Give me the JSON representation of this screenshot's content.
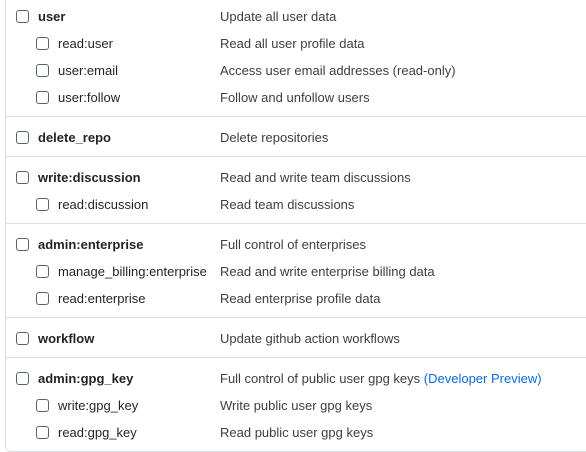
{
  "groups": [
    {
      "parent": {
        "name": "user",
        "desc": "Update all user data"
      },
      "children": [
        {
          "name": "read:user",
          "desc": "Read all user profile data"
        },
        {
          "name": "user:email",
          "desc": "Access user email addresses (read-only)"
        },
        {
          "name": "user:follow",
          "desc": "Follow and unfollow users"
        }
      ]
    },
    {
      "parent": {
        "name": "delete_repo",
        "desc": "Delete repositories"
      },
      "children": []
    },
    {
      "parent": {
        "name": "write:discussion",
        "desc": "Read and write team discussions"
      },
      "children": [
        {
          "name": "read:discussion",
          "desc": "Read team discussions"
        }
      ]
    },
    {
      "parent": {
        "name": "admin:enterprise",
        "desc": "Full control of enterprises"
      },
      "children": [
        {
          "name": "manage_billing:enterprise",
          "desc": "Read and write enterprise billing data"
        },
        {
          "name": "read:enterprise",
          "desc": "Read enterprise profile data"
        }
      ]
    },
    {
      "parent": {
        "name": "workflow",
        "desc": "Update github action workflows"
      },
      "children": []
    },
    {
      "parent": {
        "name": "admin:gpg_key",
        "desc": "Full control of public user gpg keys",
        "link": "(Developer Preview)"
      },
      "children": [
        {
          "name": "write:gpg_key",
          "desc": "Write public user gpg keys"
        },
        {
          "name": "read:gpg_key",
          "desc": "Read public user gpg keys"
        }
      ]
    }
  ]
}
